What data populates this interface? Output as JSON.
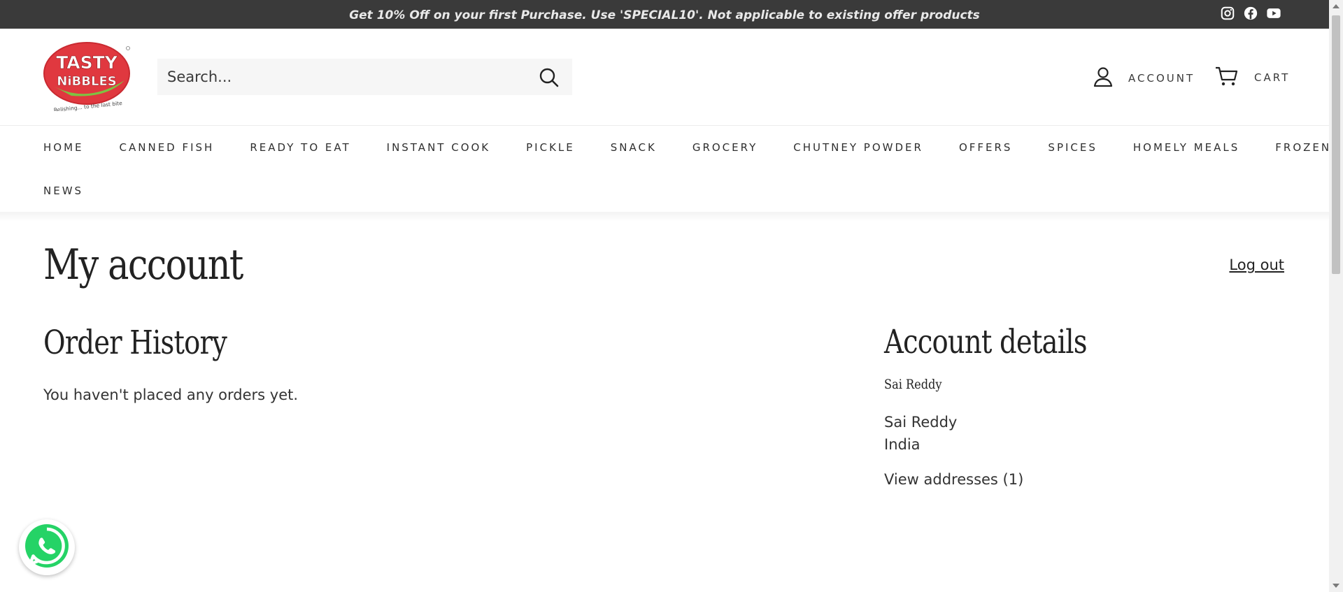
{
  "announcement": {
    "text": "Get 10% Off on your first Purchase. Use 'SPECIAL10'. Not applicable to existing offer products"
  },
  "socials": [
    "instagram-icon",
    "facebook-icon",
    "youtube-icon"
  ],
  "logo": {
    "line1": "TASTY",
    "line2": "NiBBLES",
    "tagline": "Relishing... to the last bite"
  },
  "search": {
    "placeholder": "Search..."
  },
  "header": {
    "account_label": "ACCOUNT",
    "cart_label": "CART"
  },
  "nav": {
    "row1": [
      "HOME",
      "CANNED FISH",
      "READY TO EAT",
      "INSTANT COOK",
      "PICKLE",
      "SNACK",
      "GROCERY",
      "CHUTNEY POWDER",
      "OFFERS",
      "SPICES",
      "HOMELY MEALS",
      "FROZEN"
    ],
    "row2": [
      "NEWS"
    ]
  },
  "page": {
    "title": "My account",
    "logout": "Log out",
    "order_history": {
      "heading": "Order History",
      "empty": "You haven't placed any orders yet."
    },
    "account_details": {
      "heading": "Account details",
      "name_heading": "Sai Reddy",
      "name": "Sai Reddy",
      "country": "India",
      "view_addresses": "View addresses (1)"
    }
  },
  "colors": {
    "topbar": "#3a3a3a",
    "logo_red": "#e0383f",
    "logo_green": "#7ec242",
    "whatsapp": "#25d366"
  }
}
